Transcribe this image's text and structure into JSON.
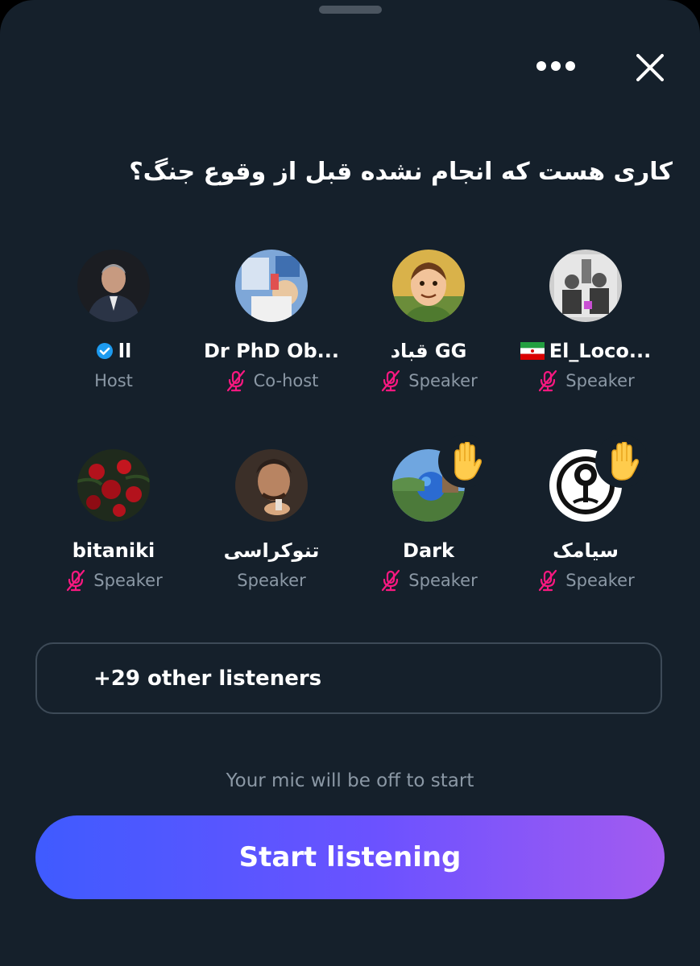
{
  "space": {
    "title": "کاری هست که انجام نشده قبل از وقوع جنگ؟"
  },
  "participants": [
    {
      "name": "اا",
      "role": "Host",
      "verified": true,
      "muted": false,
      "hand_raised": false,
      "flag": ""
    },
    {
      "name": "Dr PhD Ob...",
      "role": "Co-host",
      "verified": false,
      "muted": true,
      "hand_raised": false,
      "flag": ""
    },
    {
      "name": "قباد GG",
      "role": "Speaker",
      "verified": false,
      "muted": true,
      "hand_raised": false,
      "flag": ""
    },
    {
      "name": "El_Loco...",
      "role": "Speaker",
      "verified": false,
      "muted": true,
      "hand_raised": false,
      "flag": "iran-flag"
    },
    {
      "name": "bitaniki",
      "role": "Speaker",
      "verified": false,
      "muted": true,
      "hand_raised": false,
      "flag": ""
    },
    {
      "name": "تنوکراسی",
      "role": "Speaker",
      "verified": false,
      "muted": false,
      "hand_raised": false,
      "flag": ""
    },
    {
      "name": "Dark",
      "role": "Speaker",
      "verified": false,
      "muted": true,
      "hand_raised": true,
      "flag": ""
    },
    {
      "name": "سیامک",
      "role": "Speaker",
      "verified": false,
      "muted": true,
      "hand_raised": true,
      "flag": ""
    }
  ],
  "listeners": {
    "label": "+29 other listeners"
  },
  "footer": {
    "mic_note": "Your mic will be off to start",
    "start_label": "Start listening"
  },
  "icons": {
    "more": "more-horizontal-icon",
    "close": "close-icon",
    "muted": "mic-off-icon",
    "verified": "verified-badge-icon",
    "hand": "raised-hand-icon"
  },
  "colors": {
    "background": "#15202b",
    "muted_icon": "#f91880",
    "verified": "#1d9bf0",
    "secondary_text": "#8b98a5",
    "button_gradient_start": "#3f5bff",
    "button_gradient_end": "#a35bf0"
  }
}
